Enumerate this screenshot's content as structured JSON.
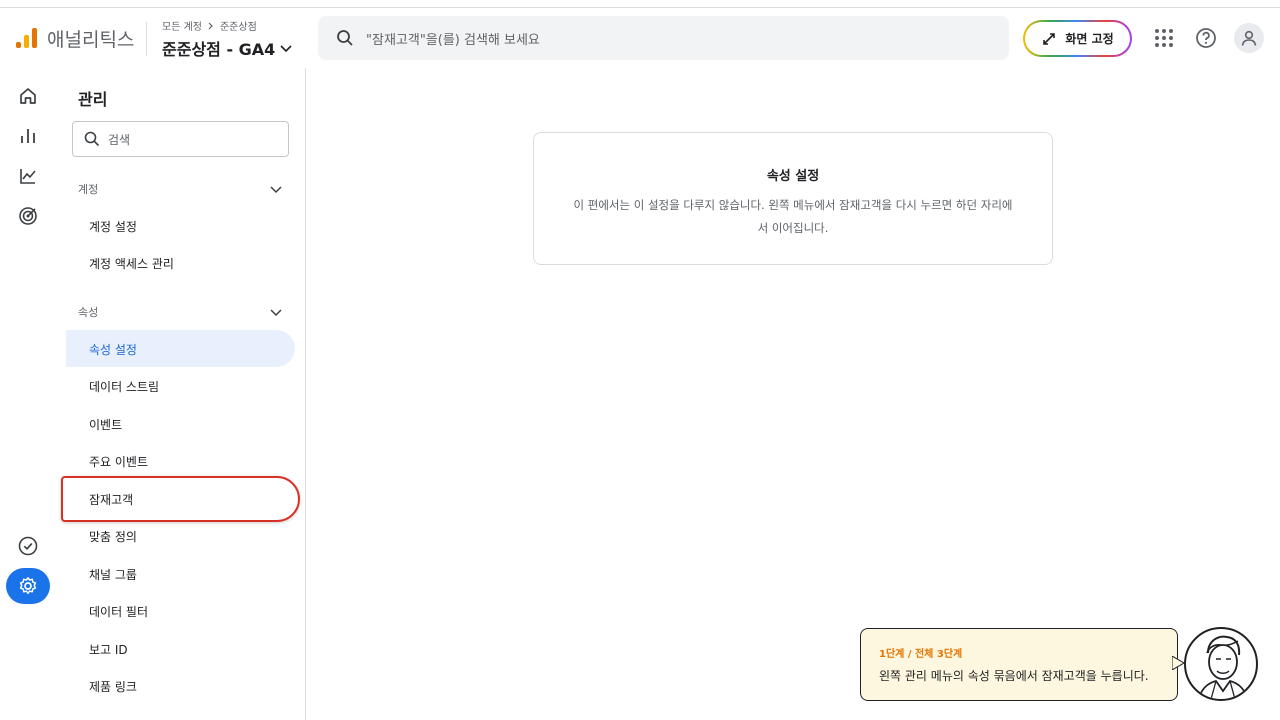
{
  "header": {
    "app_name": "애널리틱스",
    "breadcrumb": [
      "모든 계정",
      "준준상점"
    ],
    "property": "준준상점 - GA4",
    "search_placeholder": "\"잠재고객\"을(를) 검색해 보세요",
    "fix_screen_label": "화면 고정"
  },
  "rail": {
    "items": [
      "home-icon",
      "reports-icon",
      "explore-icon",
      "advertising-icon",
      "insights-icon",
      "admin-gear-icon"
    ]
  },
  "sidebar": {
    "title": "관리",
    "search_placeholder": "검색",
    "sections": [
      {
        "label": "계정",
        "items": [
          "계정 설정",
          "계정 액세스 관리"
        ]
      },
      {
        "label": "속성",
        "items": [
          "속성 설정",
          "데이터 스트림",
          "이벤트",
          "주요 이벤트",
          "잠재고객",
          "맞춤 정의",
          "채널 그룹",
          "데이터 필터",
          "보고 ID",
          "제품 링크"
        ]
      }
    ],
    "active_item": "속성 설정",
    "highlighted_item": "잠재고객"
  },
  "main": {
    "card_title": "속성 설정",
    "card_text": "이 편에서는 이 설정을 다루지 않습니다. 왼쪽 메뉴에서 잠재고객을 다시 누르면 하던 자리에서 이어집니다."
  },
  "tooltip": {
    "step": "1단계 / 전체 3단계",
    "text": "왼쪽 관리 메뉴의 속성 묶음에서 잠재고객을 누릅니다."
  },
  "colors": {
    "accent": "#1a73e8",
    "highlight": "#d93025",
    "tip_bg": "#fef7e0",
    "step": "#e37400"
  }
}
